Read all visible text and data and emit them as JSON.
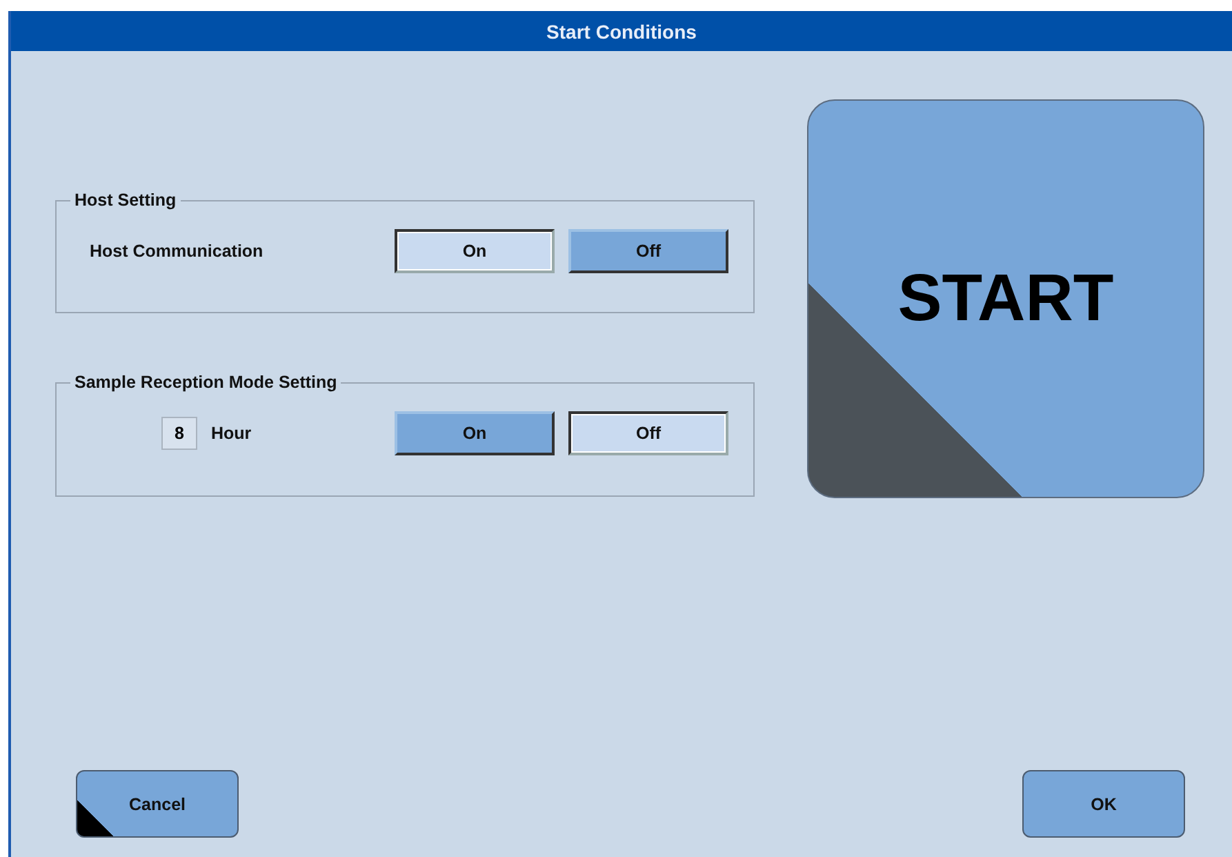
{
  "window": {
    "title": "Start Conditions"
  },
  "groups": [
    {
      "title": "Host Setting",
      "kind": "label",
      "label": "Host Communication",
      "options": [
        {
          "label": "On",
          "selected": true
        },
        {
          "label": "Off",
          "selected": false
        }
      ]
    },
    {
      "title": "Sample Reception Mode Setting",
      "kind": "hours",
      "value": "8",
      "unit": "Hour",
      "options": [
        {
          "label": "On",
          "selected": false
        },
        {
          "label": "Off",
          "selected": true
        }
      ]
    }
  ],
  "start_button": {
    "label": "START",
    "corner_mark": true
  },
  "footer_buttons": [
    {
      "label": "Cancel",
      "corner_mark": true
    },
    {
      "label": "OK",
      "corner_mark": false
    }
  ]
}
